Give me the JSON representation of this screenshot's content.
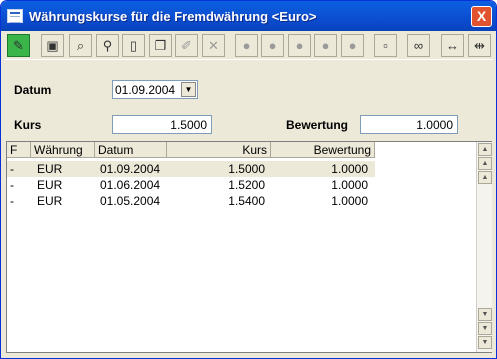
{
  "window": {
    "title": "Währungskurse für die Fremdwährung <Euro>",
    "close_label": "X"
  },
  "toolbar": {
    "buttons": [
      {
        "name": "edit-pen-button",
        "icon": "pen-icon",
        "glyph": "✎",
        "state": "active"
      },
      {
        "name": "save-button",
        "icon": "floppy-disk-icon",
        "glyph": "▣",
        "state": "normal"
      },
      {
        "name": "find-button",
        "icon": "binoculars-icon",
        "glyph": "⌕",
        "state": "normal"
      },
      {
        "name": "search-button",
        "icon": "magnifier-icon",
        "glyph": "⚲",
        "state": "normal"
      },
      {
        "name": "new-document-button",
        "icon": "document-icon",
        "glyph": "▯",
        "state": "normal"
      },
      {
        "name": "copy-record-button",
        "icon": "copy-icon",
        "glyph": "❐",
        "state": "normal"
      },
      {
        "name": "edit-record-button",
        "icon": "pencil-icon",
        "glyph": "✐",
        "state": "disabled"
      },
      {
        "name": "delete-button",
        "icon": "cross-icon",
        "glyph": "✕",
        "state": "disabled"
      },
      {
        "name": "bomb-1-button",
        "icon": "bomb-icon",
        "glyph": "●",
        "state": "disabled"
      },
      {
        "name": "bomb-2-button",
        "icon": "bomb-icon",
        "glyph": "●",
        "state": "disabled"
      },
      {
        "name": "bomb-3-button",
        "icon": "bomb-icon",
        "glyph": "●",
        "state": "disabled"
      },
      {
        "name": "bomb-4-button",
        "icon": "bomb-icon",
        "glyph": "●",
        "state": "disabled"
      },
      {
        "name": "bomb-5-button",
        "icon": "bomb-icon",
        "glyph": "●",
        "state": "disabled"
      },
      {
        "name": "minimize-panel-button",
        "icon": "minimize-icon",
        "glyph": "▫",
        "state": "normal"
      },
      {
        "name": "link-button",
        "icon": "chain-link-icon",
        "glyph": "∞",
        "state": "normal"
      },
      {
        "name": "expand-columns-button",
        "icon": "expand-arrows-icon",
        "glyph": "↔",
        "state": "normal"
      },
      {
        "name": "collapse-columns-button",
        "icon": "collapse-arrows-icon",
        "glyph": "⇹",
        "state": "normal"
      }
    ]
  },
  "form": {
    "datum_label": "Datum",
    "datum_value": "01.09.2004",
    "kurs_label": "Kurs",
    "kurs_value": "1.5000",
    "bewertung_label": "Bewertung",
    "bewertung_value": "1.0000"
  },
  "table": {
    "headers": [
      "F",
      "Währung",
      "Datum",
      "Kurs",
      "Bewertung"
    ],
    "rows": [
      {
        "f": "-",
        "waehrung": "EUR",
        "datum": "01.09.2004",
        "kurs": "1.5000",
        "bewertung": "1.0000",
        "selected": true
      },
      {
        "f": "-",
        "waehrung": "EUR",
        "datum": "01.06.2004",
        "kurs": "1.5200",
        "bewertung": "1.0000",
        "selected": false
      },
      {
        "f": "-",
        "waehrung": "EUR",
        "datum": "01.05.2004",
        "kurs": "1.5400",
        "bewertung": "1.0000",
        "selected": false
      }
    ]
  },
  "colors": {
    "titlebar": "#0a5fe0",
    "window_face": "#ece9d8",
    "active_tool": "#39b54a",
    "close_button": "#e1532e"
  }
}
